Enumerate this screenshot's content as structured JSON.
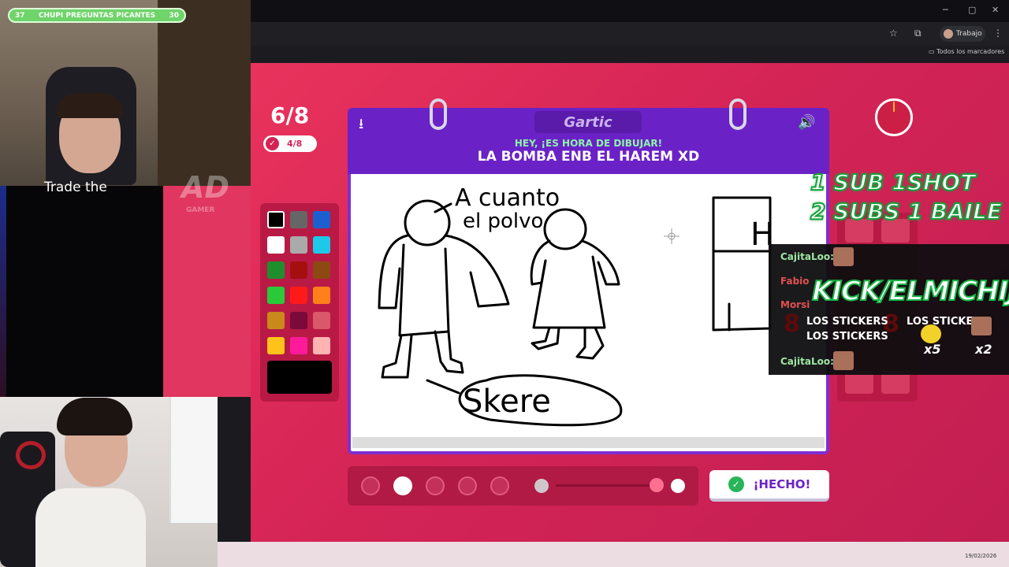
{
  "stream": {
    "poll_left": "37",
    "poll_title": "CHUPI PREGUNTAS PICANTES",
    "poll_right": "30",
    "overlay_text": "Trade the",
    "logo": "AD",
    "logo_sub": "GAMER"
  },
  "browser": {
    "profile": "Trabajo",
    "bookmarks": "Todos los marcadores",
    "win_min": "─",
    "win_max": "▢",
    "win_close": "✕",
    "star_icon": "☆",
    "ext_icon": "⧉",
    "menu_icon": "⋮",
    "bookmark_icon": "▭"
  },
  "game": {
    "round": "6/8",
    "round_done": "4/8",
    "logo": "Gartic",
    "hint": "HEY, ¡ES HORA DE DIBUJAR!",
    "word": "LA BOMBA ENB EL HAREM XD",
    "done_label": "¡HECHO!",
    "download_icon": "⭳",
    "sound_icon": "🔊",
    "check_icon": "✓",
    "brush_selected_index": 1,
    "drawing": {
      "text1": "A cuanto",
      "text2": "el polvo",
      "text3": "Skere",
      "text4": "H"
    }
  },
  "palette": [
    "#000000",
    "#666666",
    "#1e5fd0",
    "#ffffff",
    "#aaaaaa",
    "#1ec8e8",
    "#1f8f2e",
    "#a50f0f",
    "#8c4a12",
    "#29c93a",
    "#ff1a1a",
    "#ff7f1a",
    "#c9891b",
    "#7a0a3a",
    "#d9586a",
    "#ffc21a",
    "#ff1a9c",
    "#ffb3b3"
  ],
  "palette_selected": "#000000",
  "overlays": {
    "promo1": "1 SUB  1SHOT",
    "promo2": "2 SUBS 1 BAILE",
    "kick": "KICK/ELMICHIJ",
    "alert_user1": "CajitaLoo:",
    "alert_user2": "Fabio",
    "alert_user3": "Morsi",
    "alert_user4": "CajitaLoo:",
    "sticker1": "LOS STICKERS",
    "sticker2": "LOS STICKERS",
    "sticker3": "LOS STICKERS",
    "sticker4": "LOS STICKERS",
    "x5": "x5",
    "x2": "x2"
  },
  "taskbar": {
    "date": "19/02/2026"
  }
}
